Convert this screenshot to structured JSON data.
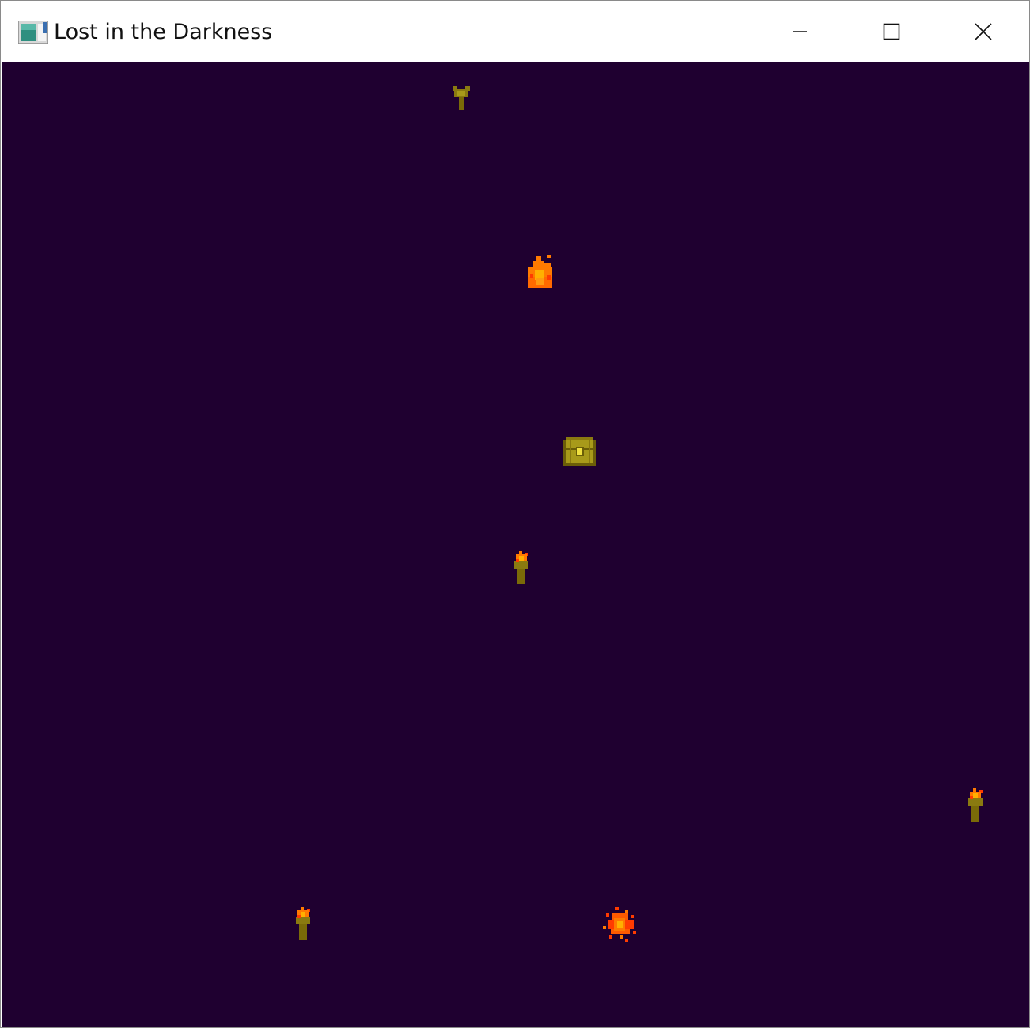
{
  "window": {
    "title": "Lost in the Darkness",
    "icon": "app-window-icon",
    "controls": {
      "minimize_icon": "minimize-icon",
      "maximize_icon": "maximize-icon",
      "close_icon": "close-icon"
    }
  },
  "game": {
    "background_color": "#1f0030",
    "colors": {
      "torch_handle": "#8a7a10",
      "flame_orange": "#ff7a00",
      "flame_red": "#ff3b00",
      "flame_yellow": "#ffb000",
      "chest_gold": "#a89a1a",
      "chest_dark": "#6b5e08",
      "chest_lock": "#f0e040"
    },
    "sprites": [
      {
        "kind": "unlit-torch",
        "icon": "unlit-torch-icon"
      },
      {
        "kind": "campfire",
        "icon": "flame-icon"
      },
      {
        "kind": "treasure-chest",
        "icon": "treasure-chest-icon"
      },
      {
        "kind": "lit-torch",
        "icon": "torch-icon"
      },
      {
        "kind": "lit-torch",
        "icon": "torch-icon"
      },
      {
        "kind": "lit-torch",
        "icon": "torch-icon"
      },
      {
        "kind": "fire-sparkle",
        "icon": "fire-burst-icon"
      }
    ]
  }
}
